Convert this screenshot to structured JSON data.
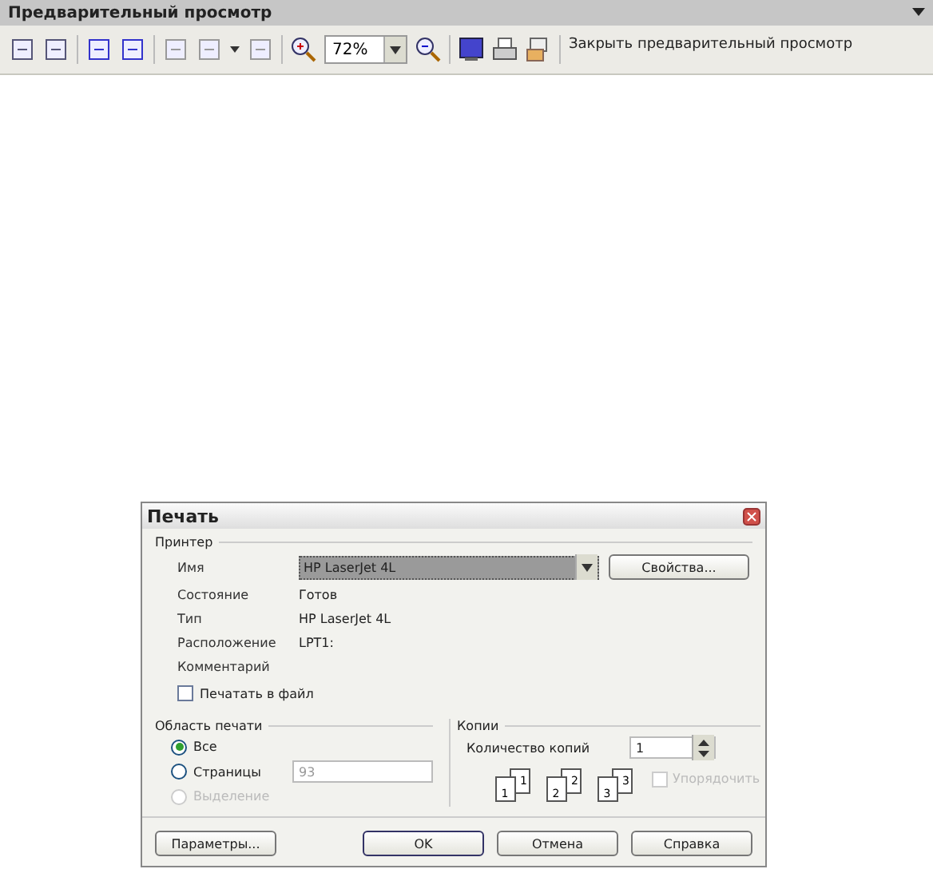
{
  "toolbar": {
    "title": "Предварительный просмотр",
    "zoom": "72%",
    "close_label": "Закрыть предварительный просмотр"
  },
  "dialog": {
    "title": "Печать",
    "printer": {
      "legend": "Принтер",
      "name_label": "Имя",
      "name_value": "HP LaserJet 4L",
      "properties_button": "Свойства...",
      "info": [
        {
          "label": "Состояние",
          "value": "Готов"
        },
        {
          "label": "Тип",
          "value": "HP LaserJet 4L"
        },
        {
          "label": "Расположение",
          "value": "LPT1:"
        },
        {
          "label": "Комментарий"
        }
      ],
      "print_to_file": {
        "label": "Печатать в файл",
        "checked": false
      }
    },
    "range": {
      "legend": "Область печати",
      "pages_value": "93",
      "options": [
        {
          "label": "Все",
          "selected": true,
          "disabled": false
        },
        {
          "label": "Страницы",
          "selected": false,
          "disabled": false
        },
        {
          "label": "Выделение",
          "selected": false,
          "disabled": true
        }
      ]
    },
    "copies": {
      "legend": "Копии",
      "count_label": "Количество копий",
      "count_value": "1",
      "pages": [
        {
          "back": "1",
          "front": "1"
        },
        {
          "back": "2",
          "front": "2"
        },
        {
          "back": "3",
          "front": "3"
        }
      ],
      "collate": {
        "label": "Упорядочить",
        "checked": false,
        "disabled": true
      }
    },
    "buttons": [
      "Параметры...",
      "OK",
      "Отмена",
      "Справка"
    ]
  }
}
